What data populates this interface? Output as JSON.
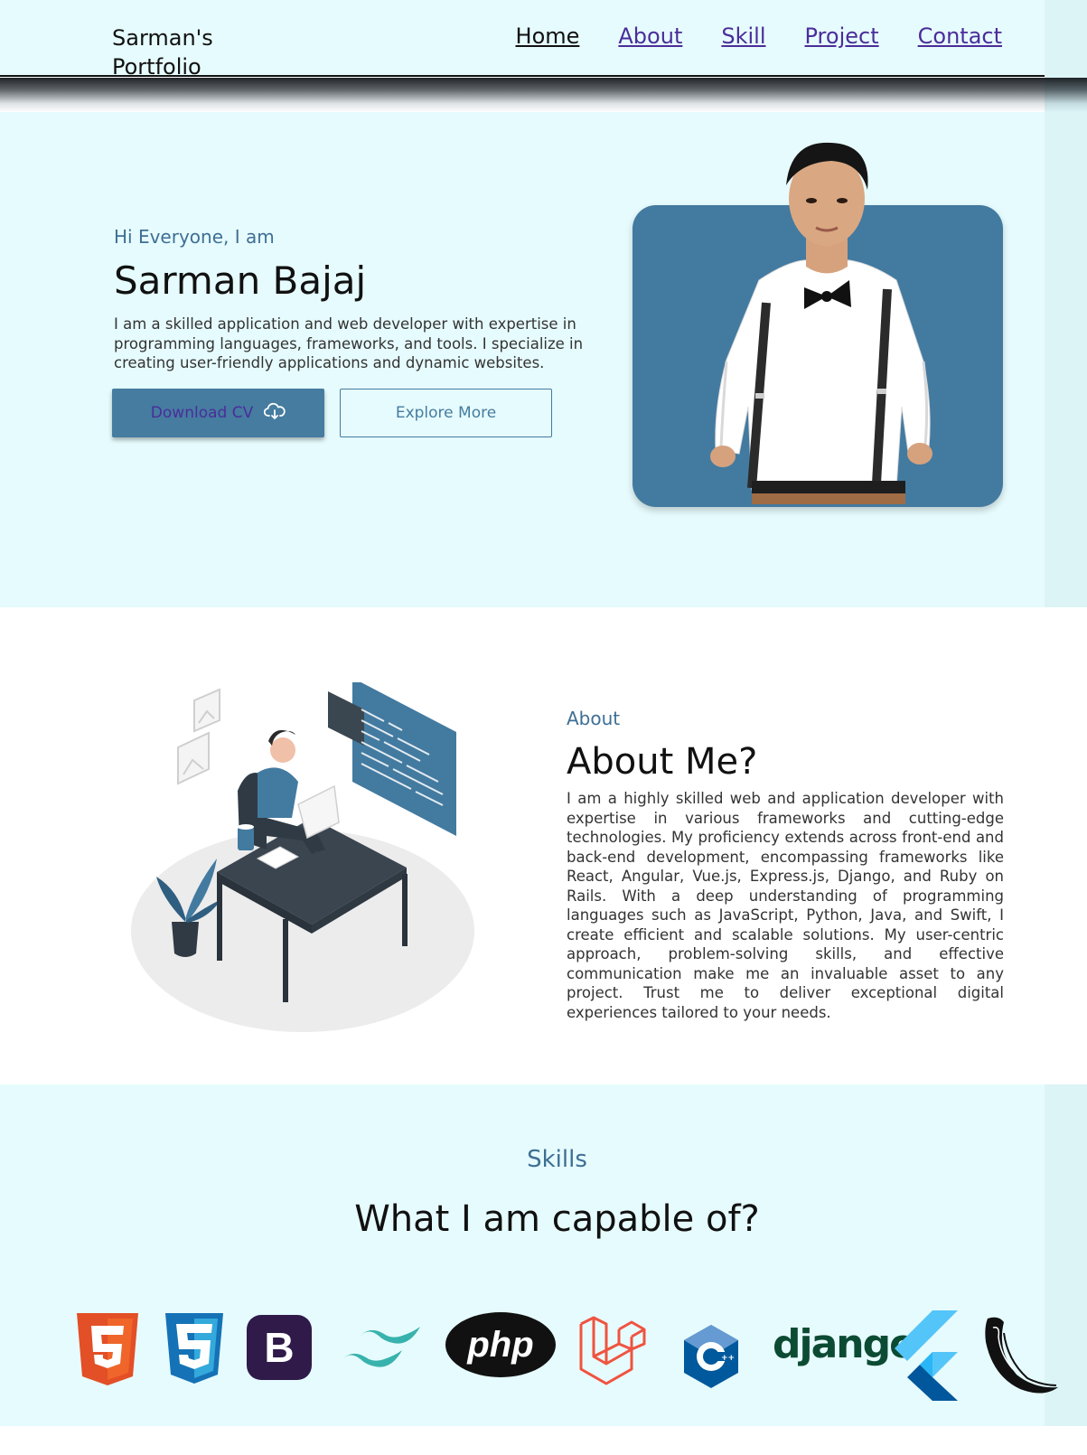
{
  "nav": {
    "brand": "Sarman's Portfolio",
    "links": [
      "Home",
      "About",
      "Skill",
      "Project",
      "Contact"
    ]
  },
  "hero": {
    "greeting": "Hi Everyone, I am",
    "name": "Sarman Bajaj",
    "description": "I am a skilled application and web developer with expertise in programming languages, frameworks, and tools. I specialize in creating user-friendly applications and dynamic websites.",
    "download_label": "Download CV",
    "explore_label": "Explore More"
  },
  "about": {
    "label": "About",
    "title": "About Me?",
    "text": "I am a highly skilled web and application developer with expertise in various frameworks and cutting-edge technologies. My proficiency extends across front-end and back-end development, encompassing frameworks like React, Angular, Vue.js, Express.js, Django, and Ruby on Rails. With a deep understanding of programming languages such as JavaScript, Python, Java, and Swift, I create efficient and scalable solutions. My user-centric approach, problem-solving skills, and effective communication make me an invaluable asset to any project. Trust me to deliver exceptional digital experiences tailored to your needs."
  },
  "skills": {
    "label": "Skills",
    "title": "What I am capable of?",
    "logos": [
      "html5-icon",
      "css3-icon",
      "bootstrap-icon",
      "tailwind-icon",
      "php-icon",
      "laravel-icon",
      "cpp-icon",
      "django-icon",
      "flutter-icon",
      "flask-icon"
    ],
    "logo_text": {
      "bootstrap": "B",
      "php": "php",
      "cpp": "C++",
      "django": "django"
    }
  },
  "colors": {
    "accent": "#437aa0",
    "background": "#e6fbfd",
    "link": "#4b2d9a"
  }
}
